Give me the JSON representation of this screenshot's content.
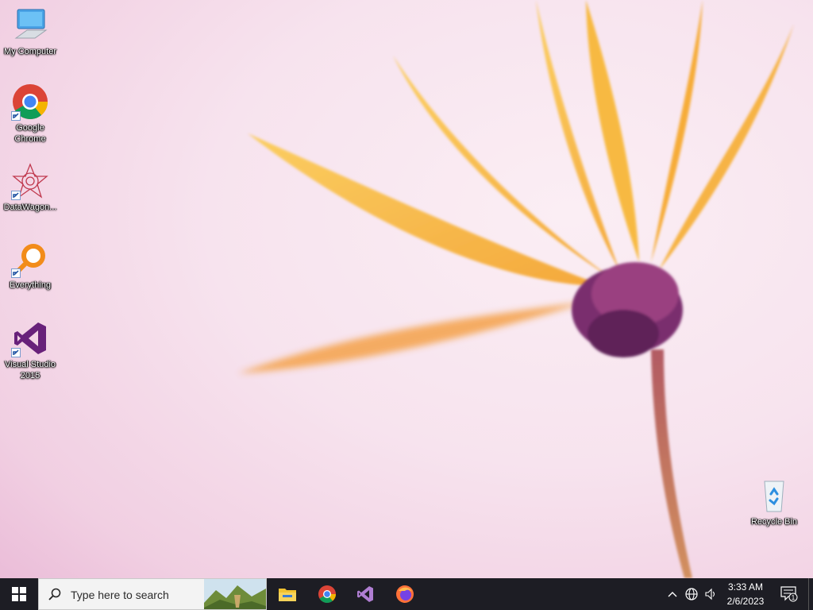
{
  "desktop": {
    "icons": [
      {
        "label": "My Computer"
      },
      {
        "label": "Google Chrome"
      },
      {
        "label": "DataWagon..."
      },
      {
        "label": "Everything"
      },
      {
        "label": "Visual Studio 2015"
      },
      {
        "label": "Recycle Bin"
      }
    ]
  },
  "taskbar": {
    "search_placeholder": "Type here to search",
    "apps": [
      "file-explorer",
      "google-chrome",
      "visual-studio",
      "firefox"
    ],
    "clock": {
      "time": "3:33 AM",
      "date": "2/6/2023"
    },
    "notification_count": "1"
  },
  "colors": {
    "taskbar_bg": "#1d1d24",
    "petal": "#f5b73a",
    "flower_center": "#7a2f6e"
  }
}
